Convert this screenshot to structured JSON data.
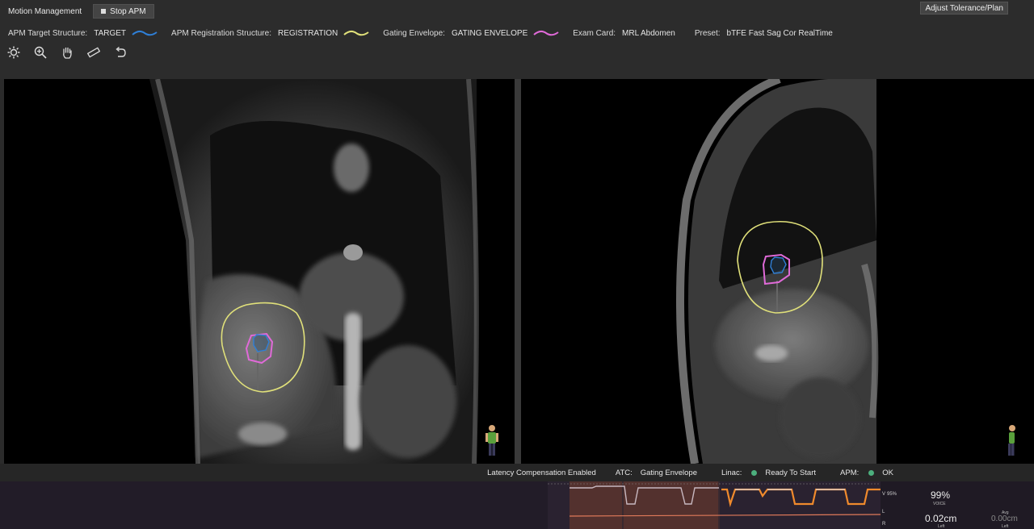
{
  "header": {
    "title": "Motion Management",
    "stop_button": "Stop APM",
    "adjust_button": "Adjust Tolerance/Plan"
  },
  "info": {
    "target_label": "APM Target Structure:",
    "target_value": "TARGET",
    "registration_label": "APM Registration Structure:",
    "registration_value": "REGISTRATION",
    "gating_label": "Gating Envelope:",
    "gating_value": "GATING ENVELOPE",
    "exam_label": "Exam Card:",
    "exam_value": "MRL Abdomen",
    "preset_label": "Preset:",
    "preset_value": "bTFE Fast Sag Cor RealTime"
  },
  "colors": {
    "target": "#2f7fd6",
    "registration": "#e0e07a",
    "gating": "#e06ad8",
    "status_ok": "#4caf7d",
    "trace_orange": "#f08a2c"
  },
  "tools": [
    "brightness-icon",
    "zoom-icon",
    "pan-hand-icon",
    "ruler-icon",
    "undo-icon"
  ],
  "status": {
    "latency": "Latency Compensation Enabled",
    "atc_label": "ATC:",
    "atc_value": "Gating Envelope",
    "linac_label": "Linac:",
    "linac_value": "Ready To Start",
    "apm_label": "APM:",
    "apm_value": "OK"
  },
  "metrics": {
    "v_label": "V",
    "v_percent": "95%",
    "voice_value": "99%",
    "voice_label": "VOICE",
    "l_label": "L",
    "r_label": "R",
    "left_value": "0.02cm",
    "left_label": "Left",
    "avg_label": "Avg",
    "avg_value": "0.00cm",
    "avg_sub": "Left"
  }
}
